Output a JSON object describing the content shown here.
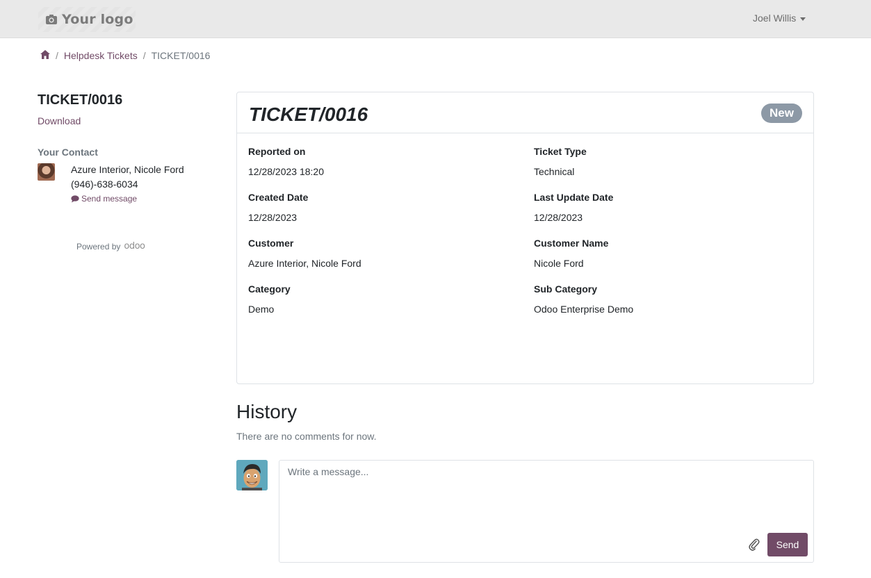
{
  "header": {
    "logo_text": "Your logo",
    "logo_icon": "camera-icon",
    "user_name": "Joel Willis"
  },
  "breadcrumb": {
    "home_icon": "home-icon",
    "items": [
      "Helpdesk Tickets",
      "TICKET/0016"
    ]
  },
  "sidebar": {
    "title": "TICKET/0016",
    "download_label": "Download",
    "contact_heading": "Your Contact",
    "contact_name": "Azure Interior, Nicole Ford",
    "contact_phone": "(946)-638-6034",
    "send_message_label": "Send message",
    "powered_by": "Powered by",
    "powered_brand": "odoo"
  },
  "ticket": {
    "title": "TICKET/0016",
    "status": "New",
    "status_color": "#8d99a6",
    "fields": [
      {
        "label": "Reported on",
        "value": "12/28/2023 18:20"
      },
      {
        "label": "Ticket Type",
        "value": "Technical"
      },
      {
        "label": "Created Date",
        "value": "12/28/2023"
      },
      {
        "label": "Last Update Date",
        "value": "12/28/2023"
      },
      {
        "label": "Customer",
        "value": "Azure Interior, Nicole Ford"
      },
      {
        "label": "Customer Name",
        "value": "Nicole Ford"
      },
      {
        "label": "Category",
        "value": "Demo"
      },
      {
        "label": "Sub Category",
        "value": "Odoo Enterprise Demo"
      }
    ]
  },
  "history": {
    "title": "History",
    "empty_text": "There are no comments for now.",
    "composer_placeholder": "Write a message...",
    "send_label": "Send",
    "attach_icon": "paperclip-icon"
  },
  "colors": {
    "accent": "#714b67",
    "topbar_bg": "#e9e9e9"
  }
}
